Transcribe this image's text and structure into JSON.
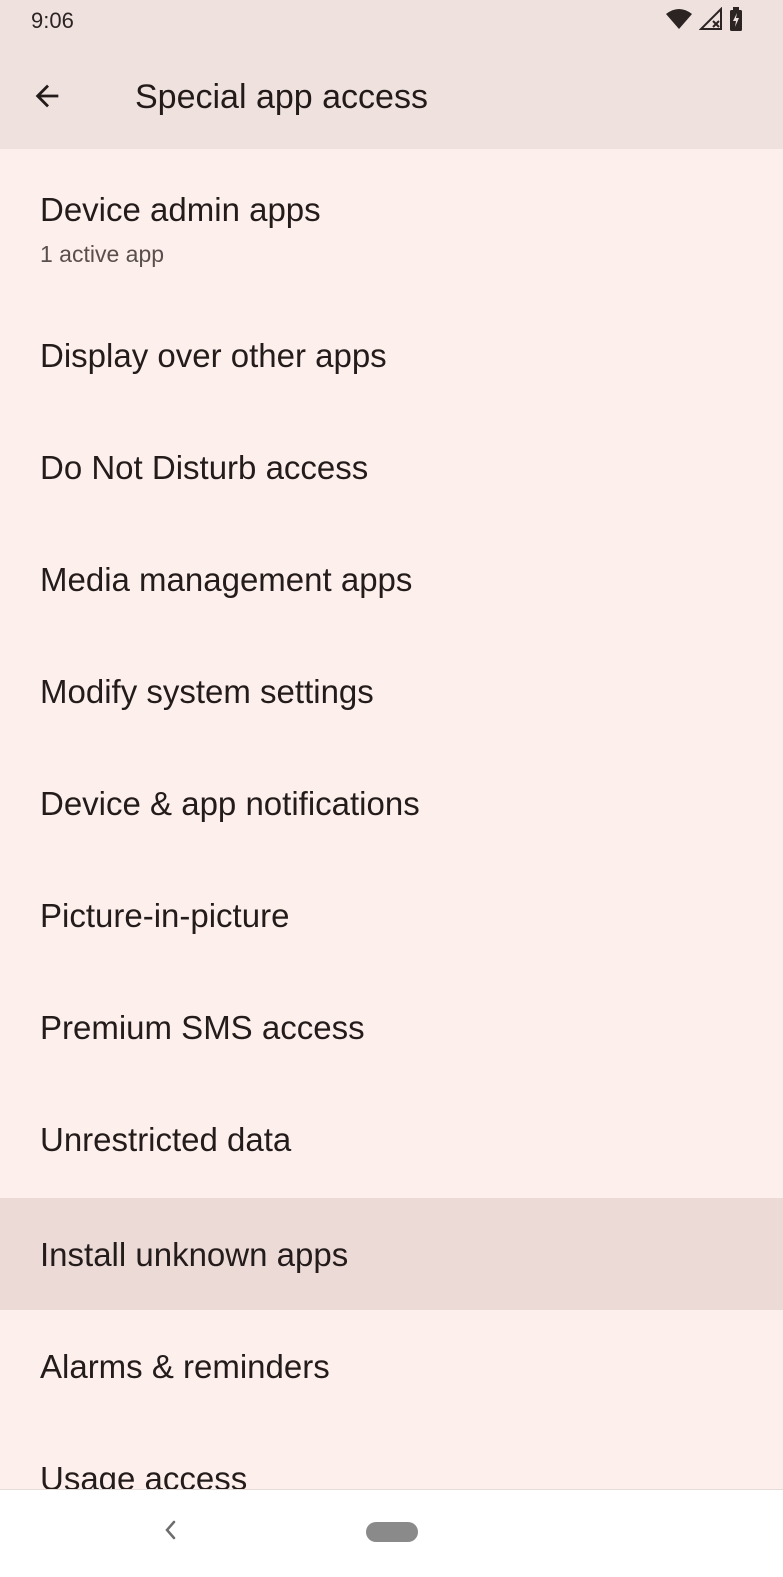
{
  "status_bar": {
    "time": "9:06",
    "icons": [
      "wifi-icon",
      "signal-icon",
      "battery-charging-icon"
    ]
  },
  "app_bar": {
    "back_icon": "arrow-left-icon",
    "title": "Special app access"
  },
  "list": {
    "items": [
      {
        "label": "Device admin apps",
        "sub": "1 active app"
      },
      {
        "label": "Display over other apps"
      },
      {
        "label": "Do Not Disturb access"
      },
      {
        "label": "Media management apps"
      },
      {
        "label": "Modify system settings"
      },
      {
        "label": "Device & app notifications"
      },
      {
        "label": "Picture-in-picture"
      },
      {
        "label": "Premium SMS access"
      },
      {
        "label": "Unrestricted data"
      },
      {
        "label": "Install unknown apps",
        "highlighted": true
      },
      {
        "label": "Alarms & reminders"
      },
      {
        "label": "Usage access"
      }
    ]
  },
  "nav_bar": {
    "back_icon": "chevron-left-icon",
    "home_icon": "home-pill-icon"
  },
  "colors": {
    "background": "#fdefec",
    "app_bar": "#efe1dd",
    "highlight": "#ecdad7"
  }
}
